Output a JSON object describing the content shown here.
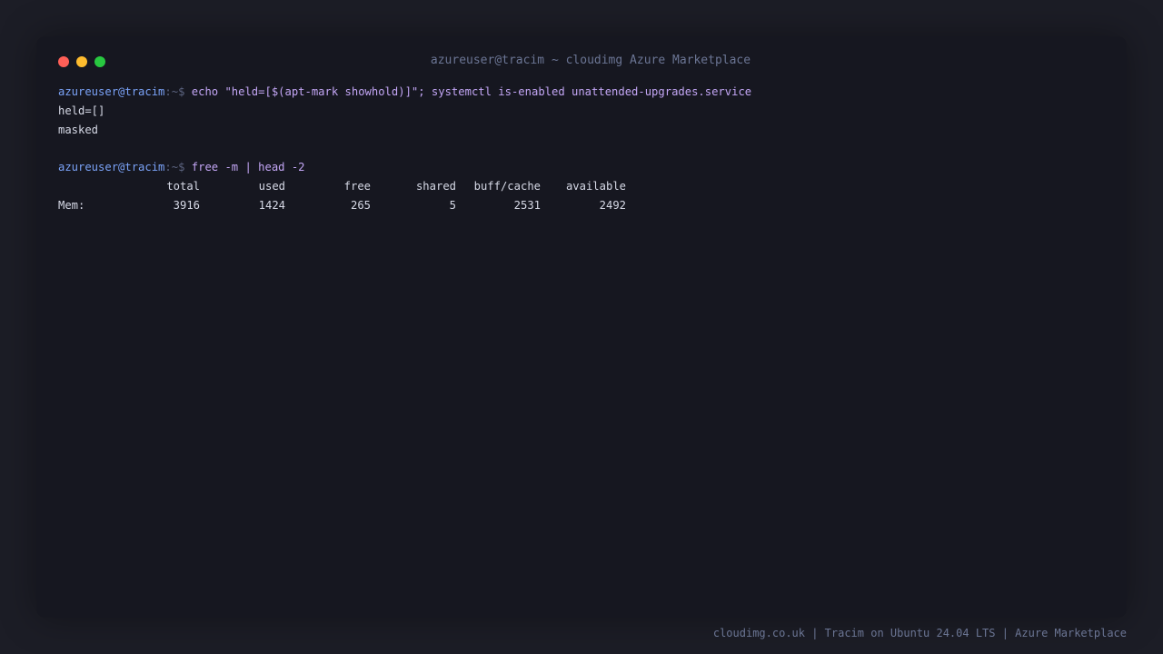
{
  "window": {
    "title": "azureuser@tracim ~ cloudimg Azure Marketplace",
    "controls": {
      "close_color": "#ff5f57",
      "minimize_color": "#febc2e",
      "maximize_color": "#28c840"
    }
  },
  "terminal": {
    "prompt_user": "azureuser@tracim",
    "prompt_sep": ":~$",
    "commands": [
      "echo \"held=[$(apt-mark showhold)]\"; systemctl is-enabled unattended-upgrades.service",
      "free -m | head -2"
    ],
    "output1": [
      "held=[]",
      "masked"
    ],
    "mem_table": {
      "headers": [
        "",
        "total",
        "used",
        "free",
        "shared",
        "buff/cache",
        "available"
      ],
      "row": [
        "Mem:",
        "3916",
        "1424",
        "265",
        "5",
        "2531",
        "2492"
      ]
    }
  },
  "footer": {
    "text": "cloudimg.co.uk | Tracim on Ubuntu 24.04 LTS | Azure Marketplace"
  },
  "colors": {
    "background": "#1c1d26",
    "terminal_bg": "#161720",
    "prompt": "#7aa2f7",
    "command": "#c3a6f5",
    "output": "#d6d9e6"
  }
}
